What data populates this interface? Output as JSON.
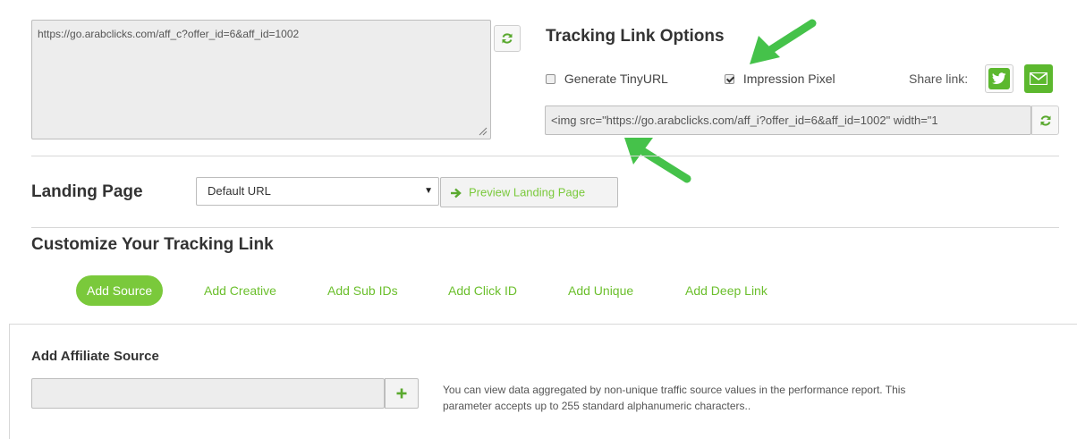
{
  "tracking": {
    "link_value": "https://go.arabclicks.com/aff_c?offer_id=6&aff_id=1002",
    "refresh_icon": "refresh-icon"
  },
  "options": {
    "title": "Tracking Link Options",
    "generate_tinyurl_label": "Generate TinyURL",
    "generate_tinyurl_checked": false,
    "impression_pixel_label": "Impression Pixel",
    "impression_pixel_checked": true,
    "share_label": "Share link:",
    "share_icons": [
      "twitter-icon",
      "email-icon"
    ],
    "pixel_code": "<img src=\"https://go.arabclicks.com/aff_i?offer_id=6&aff_id=1002\" width=\"1"
  },
  "landing": {
    "label": "Landing Page",
    "selected": "Default URL",
    "preview_label": "Preview Landing Page"
  },
  "customize": {
    "title": "Customize Your Tracking Link",
    "tabs": [
      {
        "label": "Add Source",
        "active": true
      },
      {
        "label": "Add Creative",
        "active": false
      },
      {
        "label": "Add Sub IDs",
        "active": false
      },
      {
        "label": "Add Click ID",
        "active": false
      },
      {
        "label": "Add Unique",
        "active": false
      },
      {
        "label": "Add Deep Link",
        "active": false
      }
    ]
  },
  "affiliate": {
    "title": "Add Affiliate Source",
    "input_value": "",
    "help_line1": "You can view data aggregated by non-unique traffic source values in the performance report. This",
    "help_line2": "parameter accepts up to 255 standard alphanumeric characters.."
  },
  "colors": {
    "accent_green": "#7ac93b",
    "annotation_arrow": "#45c24a"
  }
}
